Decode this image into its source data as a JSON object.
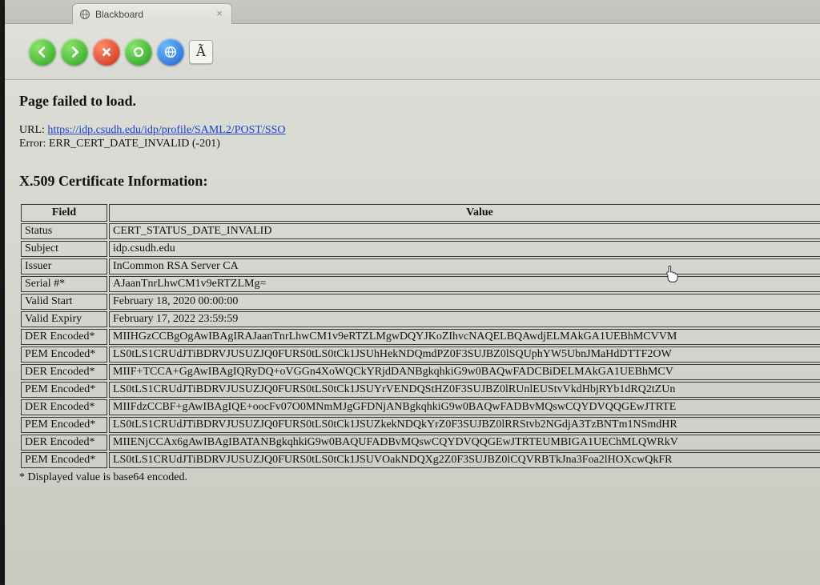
{
  "tab": {
    "title": "Blackboard"
  },
  "toolbar": {
    "font_button": "Ã"
  },
  "page": {
    "title": "Page failed to load.",
    "url_label": "URL:",
    "url": "https://idp.csudh.edu/idp/profile/SAML2/POST/SSO",
    "error_label": "Error:",
    "error": "ERR_CERT_DATE_INVALID (-201)",
    "cert_title": "X.509 Certificate Information:",
    "th_field": "Field",
    "th_value": "Value",
    "rows": [
      {
        "field": "Status",
        "value": "CERT_STATUS_DATE_INVALID"
      },
      {
        "field": "Subject",
        "value": "idp.csudh.edu"
      },
      {
        "field": "Issuer",
        "value": "InCommon RSA Server CA"
      },
      {
        "field": "Serial #*",
        "value": "AJaanTnrLhwCM1v9eRTZLMg="
      },
      {
        "field": "Valid Start",
        "value": "February 18, 2020 00:00:00"
      },
      {
        "field": "Valid Expiry",
        "value": "February 17, 2022 23:59:59"
      },
      {
        "field": "DER Encoded*",
        "value": "MIIHGzCCBgOgAwIBAgIRAJaanTnrLhwCM1v9eRTZLMgwDQYJKoZIhvcNAQELBQAwdjELMAkGA1UEBhMCVVM"
      },
      {
        "field": "PEM Encoded*",
        "value": "LS0tLS1CRUdJTiBDRVJUSUZJQ0FURS0tLS0tCk1JSUhHekNDQmdPZ0F3SUJBZ0lSQUphYW5UbnJMaHdDTTF2OW"
      },
      {
        "field": "DER Encoded*",
        "value": "MIIF+TCCA+GgAwIBAgIQRyDQ+oVGGn4XoWQCkYRjdDANBgkqhkiG9w0BAQwFADCBiDELMAkGA1UEBhMCV"
      },
      {
        "field": "PEM Encoded*",
        "value": "LS0tLS1CRUdJTiBDRVJUSUZJQ0FURS0tLS0tCk1JSUYrVENDQStHZ0F3SUJBZ0lRUnlEUStvVkdHbjRYb1dRQ2tZUn"
      },
      {
        "field": "DER Encoded*",
        "value": "MIIFdzCCBF+gAwIBAgIQE+oocFv07O0MNmMJgGFDNjANBgkqhkiG9w0BAQwFADBvMQswCQYDVQQGEwJTRTE"
      },
      {
        "field": "PEM Encoded*",
        "value": "LS0tLS1CRUdJTiBDRVJUSUZJQ0FURS0tLS0tCk1JSUZkekNDQkYrZ0F3SUJBZ0lRRStvb2NGdjA3TzBNTm1NSmdHR"
      },
      {
        "field": "DER Encoded*",
        "value": "MIIENjCCAx6gAwIBAgIBATANBgkqhkiG9w0BAQUFADBvMQswCQYDVQQGEwJTRTEUMBIGA1UEChMLQWRkV"
      },
      {
        "field": "PEM Encoded*",
        "value": "LS0tLS1CRUdJTiBDRVJUSUZJQ0FURS0tLS0tCk1JSUVOakNDQXg2Z0F3SUJBZ0lCQVRBTkJna3Foa2lHOXcwQkFR"
      }
    ],
    "footnote": "* Displayed value is base64 encoded."
  }
}
